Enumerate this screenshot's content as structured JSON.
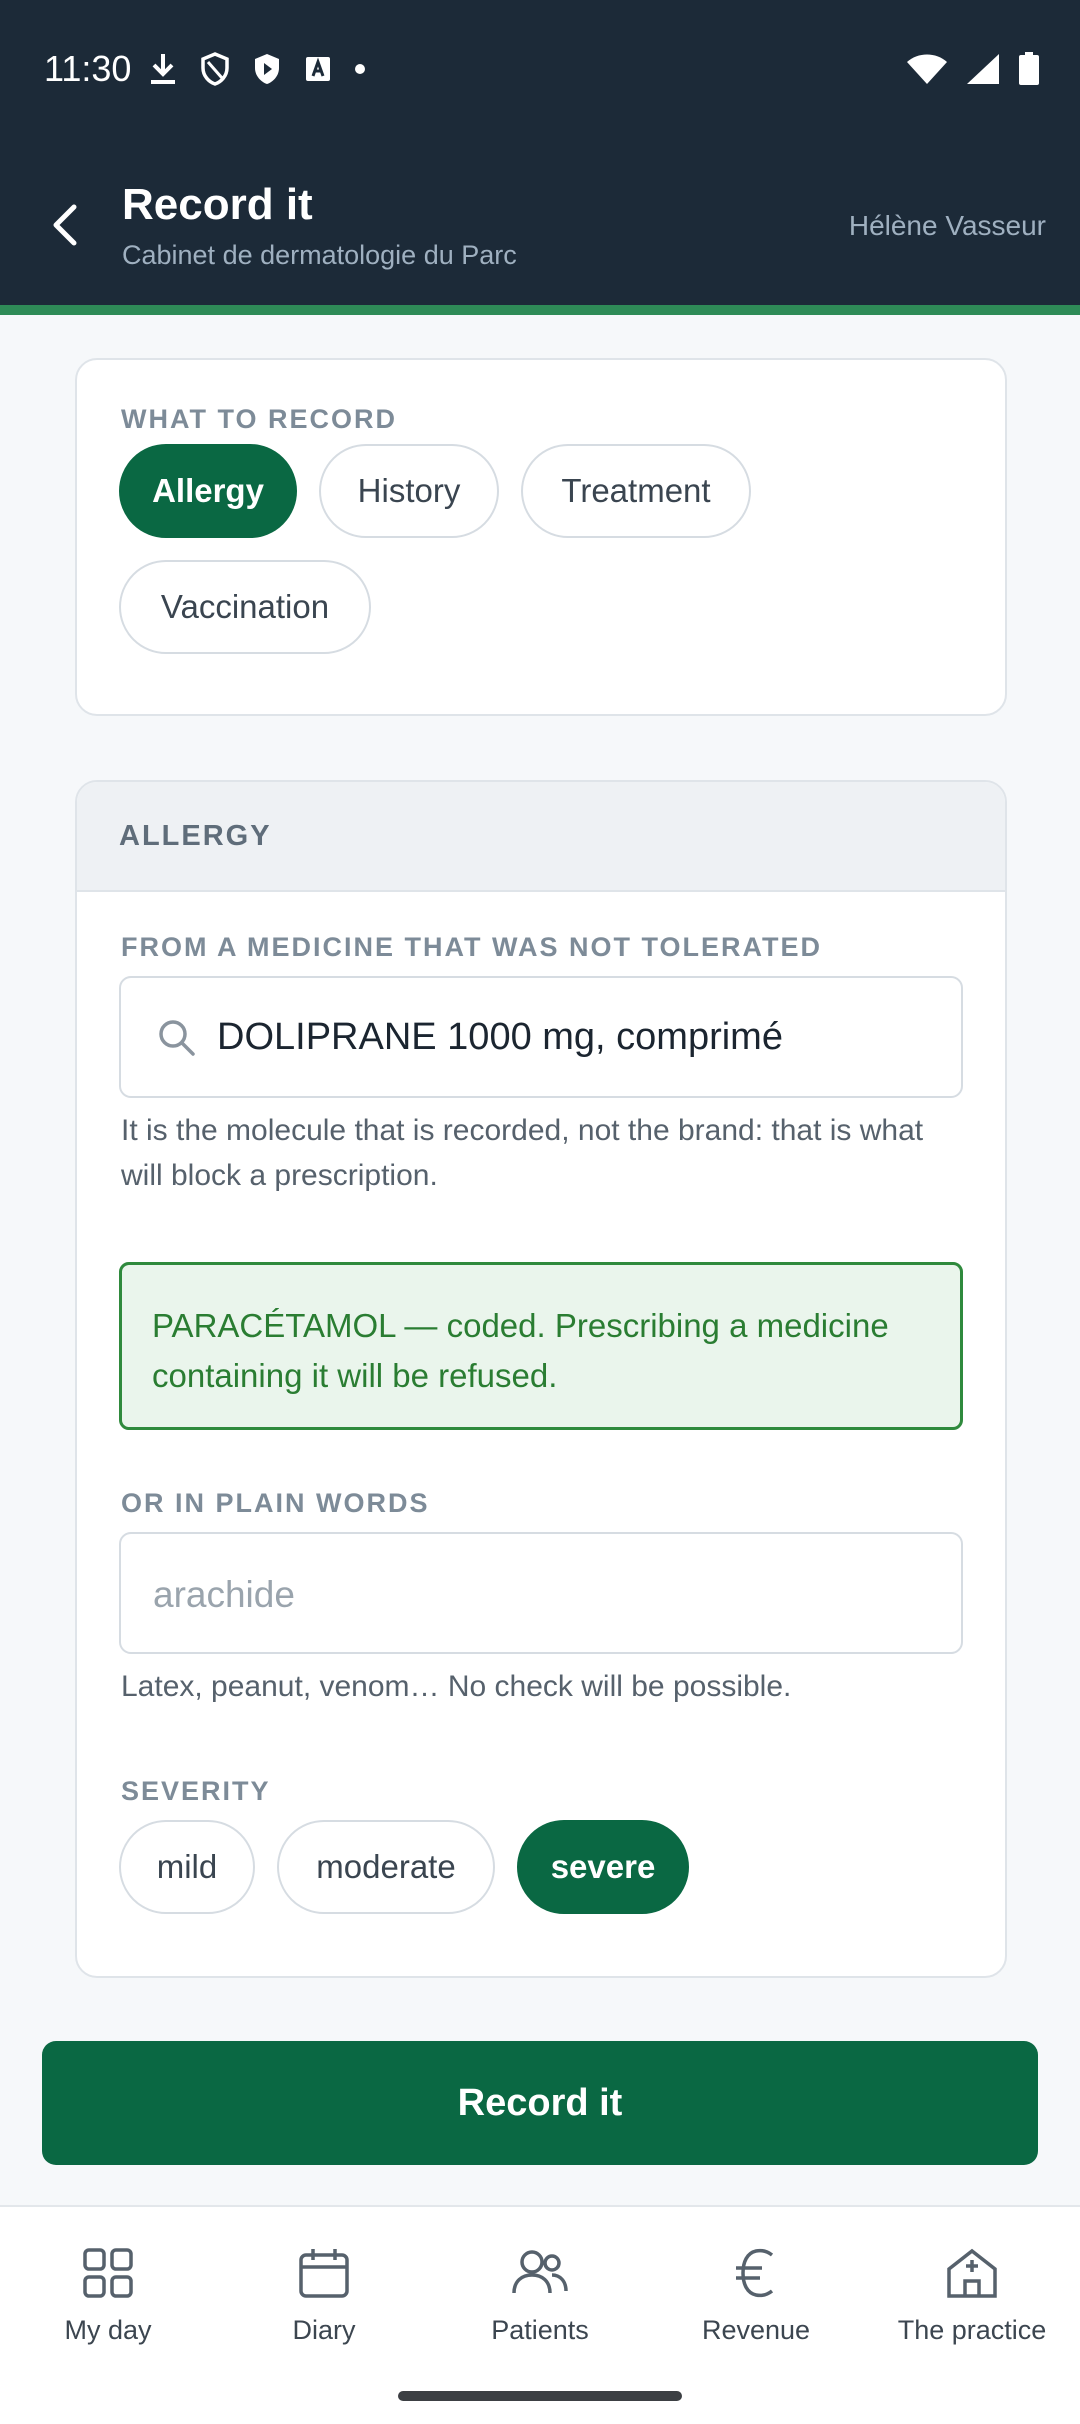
{
  "status_bar": {
    "time": "11:30"
  },
  "header": {
    "title": "Record it",
    "subtitle": "Cabinet de dermatologie du Parc",
    "user": "Hélène Vasseur"
  },
  "what_to_record": {
    "label": "WHAT TO RECORD",
    "chips": [
      "Allergy",
      "History",
      "Treatment",
      "Vaccination"
    ],
    "selected": "Allergy"
  },
  "allergy": {
    "section_title": "ALLERGY",
    "medicine_label": "FROM A MEDICINE THAT WAS NOT TOLERATED",
    "medicine_value": "DOLIPRANE 1000 mg, comprimé",
    "medicine_help": "It is the molecule that is recorded, not the brand: that is what will block a prescription.",
    "coded_message": "PARACÉTAMOL — coded. Prescribing a medicine containing it will be refused.",
    "plain_label": "OR IN PLAIN WORDS",
    "plain_placeholder": "arachide",
    "plain_help": "Latex, peanut, venom… No check will be possible.",
    "severity_label": "SEVERITY",
    "severity_options": [
      "mild",
      "moderate",
      "severe"
    ],
    "severity_selected": "severe"
  },
  "submit_label": "Record it",
  "nav": [
    {
      "label": "My day",
      "icon": "grid-icon"
    },
    {
      "label": "Diary",
      "icon": "calendar-icon"
    },
    {
      "label": "Patients",
      "icon": "people-icon"
    },
    {
      "label": "Revenue",
      "icon": "euro-icon"
    },
    {
      "label": "The practice",
      "icon": "clinic-icon"
    }
  ],
  "colors": {
    "header_bg": "#1c2a38",
    "accent": "#0a6843",
    "success_bg": "#eaf5ec",
    "success_text": "#2a7d32"
  }
}
